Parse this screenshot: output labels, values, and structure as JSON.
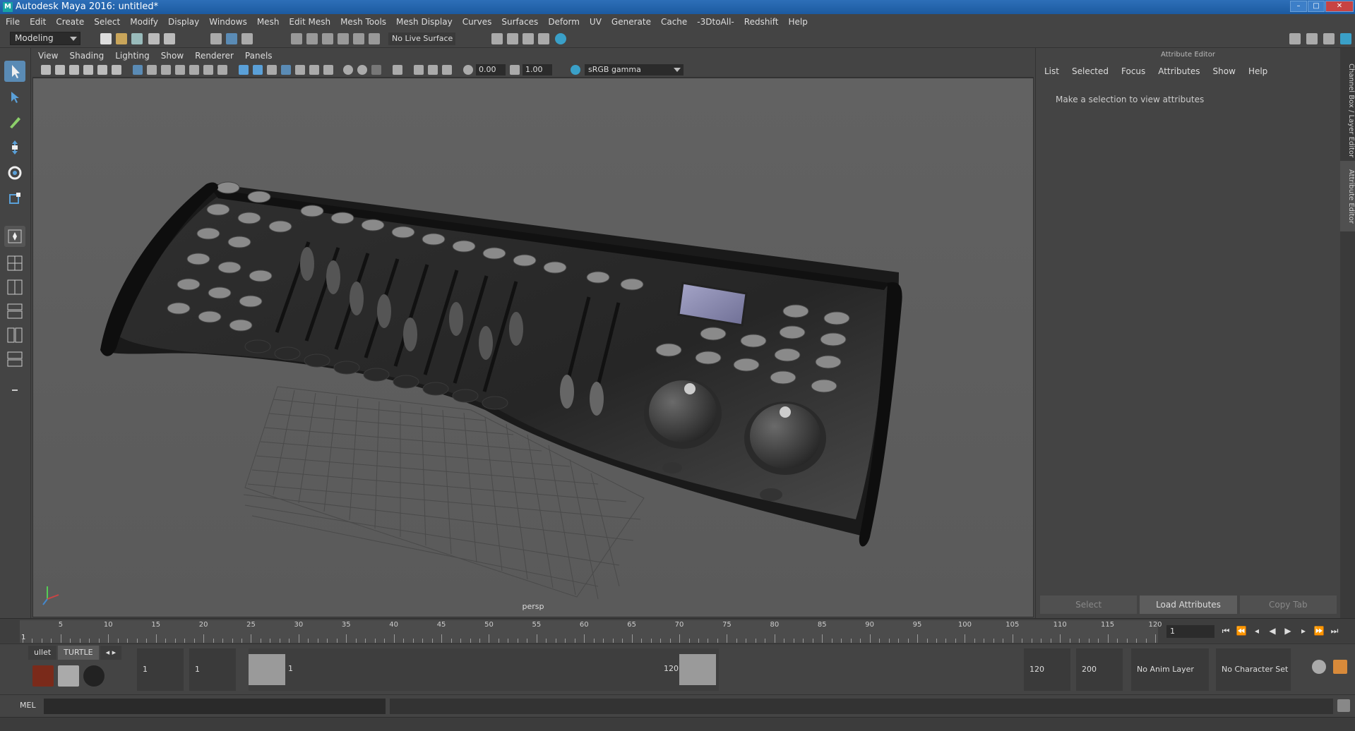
{
  "window": {
    "title": "Autodesk Maya 2016: untitled*"
  },
  "menubar": {
    "items": [
      "File",
      "Edit",
      "Create",
      "Select",
      "Modify",
      "Display",
      "Windows",
      "Mesh",
      "Edit Mesh",
      "Mesh Tools",
      "Mesh Display",
      "Curves",
      "Surfaces",
      "Deform",
      "UV",
      "Generate",
      "Cache",
      "-3DtoAll-",
      "Redshift",
      "Help"
    ]
  },
  "toolbar": {
    "mode": "Modeling",
    "live_surface": "No Live Surface"
  },
  "viewport": {
    "menu": [
      "View",
      "Shading",
      "Lighting",
      "Show",
      "Renderer",
      "Panels"
    ],
    "exposure": "0.00",
    "gamma_value": "1.00",
    "color_space": "sRGB gamma",
    "camera_label": "persp"
  },
  "attribute_editor": {
    "title": "Attribute Editor",
    "menu": [
      "List",
      "Selected",
      "Focus",
      "Attributes",
      "Show",
      "Help"
    ],
    "message": "Make a selection to view attributes",
    "buttons": {
      "select": "Select",
      "load": "Load Attributes",
      "copy": "Copy Tab"
    }
  },
  "side_tabs": {
    "channel_box": "Channel Box / Layer Editor",
    "attribute_editor": "Attribute Editor"
  },
  "timeline": {
    "ticks": [
      "5",
      "10",
      "15",
      "20",
      "25",
      "30",
      "35",
      "40",
      "45",
      "50",
      "55",
      "60",
      "65",
      "70",
      "75",
      "80",
      "85",
      "90",
      "95",
      "100",
      "105",
      "110",
      "115",
      "120"
    ],
    "start_label": "1",
    "current_frame": "1"
  },
  "range": {
    "shelf_tabs": [
      "ullet",
      "TURTLE"
    ],
    "start_time": "1",
    "playback_start": "1",
    "slider_start": "1",
    "slider_end": "120",
    "playback_end": "120",
    "end_time": "200",
    "anim_layer": "No Anim Layer",
    "character_set": "No Character Set"
  },
  "command_line": {
    "label": "MEL"
  },
  "colors": {
    "accent": "#5a8bb5",
    "title_bar": "#1c5aa0",
    "viewport_bg": "#5e5e5e",
    "panel_bg": "#444444"
  }
}
